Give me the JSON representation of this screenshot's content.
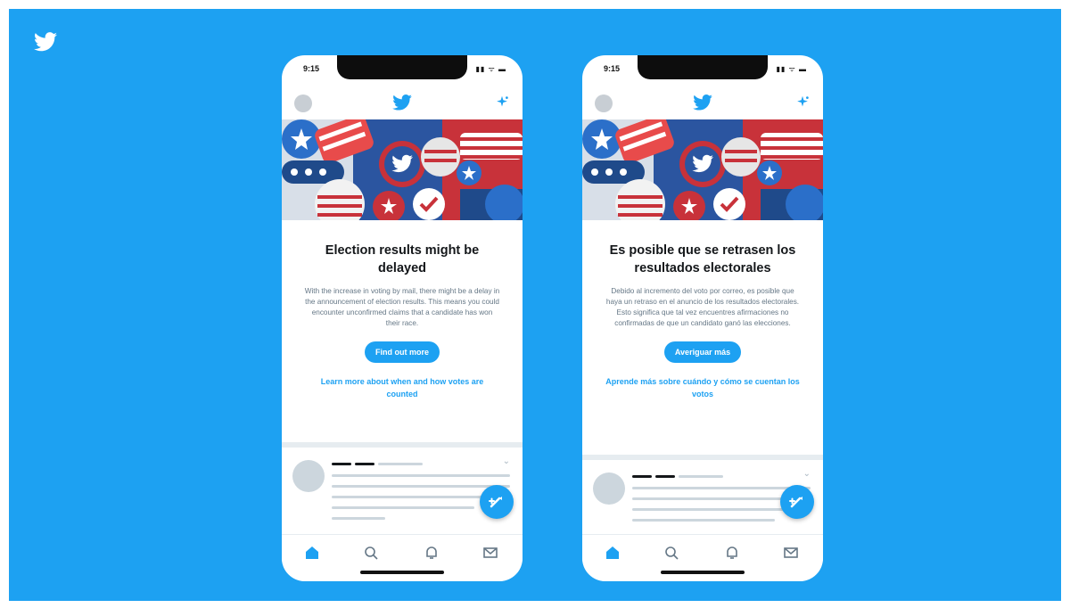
{
  "background": {
    "accent": "#1da1f2"
  },
  "brand": {
    "icon": "twitter-bird-icon"
  },
  "phones": [
    {
      "status_time": "9:15",
      "status_icons": "▮▮ ᯤ ▬",
      "card": {
        "title": "Election results might be delayed",
        "body": "With the increase in voting by mail, there might be a delay in the announcement of election results. This means you could encounter unconfirmed claims that a candidate has won their race.",
        "button": "Find out more",
        "link": "Learn more about when and how votes are counted"
      },
      "tweet": {
        "chevron": "⌄"
      },
      "tabs": [
        "home-icon",
        "search-icon",
        "notifications-icon",
        "messages-icon"
      ]
    },
    {
      "status_time": "9:15",
      "status_icons": "▮▮ ᯤ ▬",
      "card": {
        "title": "Es posible que se retrasen los resultados electorales",
        "body": "Debido al incremento del voto por correo, es posible que haya un retraso en el anuncio de los resultados electorales. Esto significa que tal vez encuentres afirmaciones no confirmadas de que un candidato ganó las elecciones.",
        "button": "Averiguar más",
        "link": "Aprende más sobre cuándo y cómo se cuentan los votos"
      },
      "tweet": {
        "chevron": "⌄"
      },
      "tabs": [
        "home-icon",
        "search-icon",
        "notifications-icon",
        "messages-icon"
      ]
    }
  ]
}
